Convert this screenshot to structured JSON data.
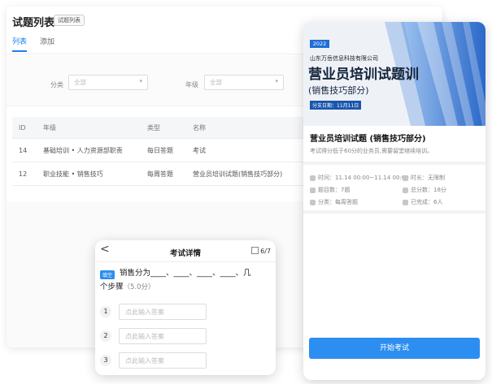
{
  "admin": {
    "title": "试题列表",
    "badge": "试题列表",
    "tabs": [
      {
        "label": "列表",
        "active": true
      },
      {
        "label": "添加",
        "active": false
      }
    ],
    "filters": [
      {
        "label": "分类",
        "placeholder": "全部"
      },
      {
        "label": "年级",
        "placeholder": "全部"
      }
    ],
    "table": {
      "headers": [
        "ID",
        "年级",
        "类型",
        "名称"
      ],
      "rows": [
        [
          "14",
          "基础培训 • 人力资源部职责",
          "每日答题",
          "考试"
        ],
        [
          "12",
          "职业技能 • 销售技巧",
          "每周答题",
          "营业员培训试题(销售技巧部分)"
        ]
      ]
    }
  },
  "card": {
    "banner": {
      "year": "2022",
      "company": "山东万岳信息科技有限公司",
      "title": "营业员培训试题训",
      "subtitle": "(销售技巧部分)",
      "date": "分支日期：11月11日"
    },
    "title": "营业员培训试题 (销售技巧部分)",
    "desc": "考试得分低于60分的业务员,需要留堂继续培训。",
    "info": {
      "time": "时间：11.14 00:00~11.14 00:00",
      "duration": "时长：无限制",
      "count": "题目数：7题",
      "total": "总分数：18分",
      "category": "分类：每周答题",
      "done": "已完成：6人"
    },
    "start_label": "开始考试"
  },
  "modal": {
    "back": "<",
    "title": "考试详情",
    "progress": "6/7",
    "question_tag": "填空",
    "question_text": "销售分为____、____、____、____、几",
    "question_text2": "个步骤",
    "points": "（5.0分）",
    "answers": [
      {
        "num": "1",
        "placeholder": "点此输入答案"
      },
      {
        "num": "2",
        "placeholder": "点此输入答案"
      },
      {
        "num": "3",
        "placeholder": "点此输入答案"
      }
    ]
  },
  "colors": {
    "accent": "#2c8ef0",
    "banner_blue": "#1f6fd4"
  }
}
